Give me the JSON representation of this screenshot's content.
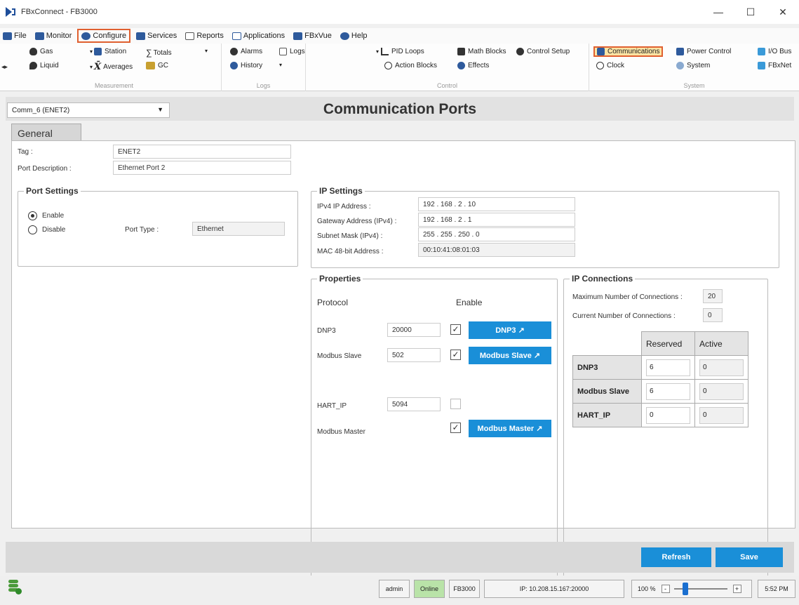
{
  "window": {
    "title": "FBxConnect - FB3000",
    "minimize": "—",
    "maximize": "☐",
    "close": "✕"
  },
  "menu": [
    {
      "label": "File",
      "icon": "folder-icon",
      "color": "#2e5a9c"
    },
    {
      "label": "Monitor",
      "icon": "monitor-icon",
      "color": "#2e5a9c"
    },
    {
      "label": "Configure",
      "icon": "gear-icon",
      "color": "#2e5a9c",
      "selected": true
    },
    {
      "label": "Services",
      "icon": "tools-icon",
      "color": "#2e5a9c"
    },
    {
      "label": "Reports",
      "icon": "report-icon",
      "color": "#555555"
    },
    {
      "label": "Applications",
      "icon": "apps-icon",
      "color": "#2e5a9c"
    },
    {
      "label": "FBxVue",
      "icon": "vue-icon",
      "color": "#2e5a9c"
    },
    {
      "label": "Help",
      "icon": "help-icon",
      "color": "#2e5a9c"
    }
  ],
  "ribbon": {
    "measurement": {
      "label": "Measurement",
      "gas": "Gas",
      "liquid": "Liquid",
      "station": "Station",
      "averages": "Averages",
      "totals": "Totals",
      "gc": "GC"
    },
    "logs": {
      "label": "Logs",
      "alarms": "Alarms",
      "history": "History",
      "logs": "Logs"
    },
    "control": {
      "label": "Control",
      "pid_loops": "PID Loops",
      "action_blocks": "Action Blocks",
      "math_blocks": "Math Blocks",
      "effects": "Effects",
      "control_setup": "Control Setup"
    },
    "system": {
      "label": "System",
      "communications": "Communications",
      "clock": "Clock",
      "power_control": "Power Control",
      "system": "System",
      "io_bus": "I/O Bus",
      "fbxnet": "FBxNet"
    }
  },
  "header": {
    "port_select": "Comm_6 (ENET2)",
    "title": "Communication Ports"
  },
  "tabs": {
    "general": "General"
  },
  "general": {
    "tag_label": "Tag :",
    "tag_value": "ENET2",
    "desc_label": "Port Description :",
    "desc_value": "Ethernet Port 2"
  },
  "port_settings": {
    "title": "Port Settings",
    "enable": "Enable",
    "disable": "Disable",
    "port_type_label": "Port Type :",
    "port_type_value": "Ethernet"
  },
  "ip_settings": {
    "title": "IP Settings",
    "ipv4_label": "IPv4 IP Address :",
    "ipv4_value": "192 . 168 . 2 . 10",
    "gateway_label": "Gateway Address (IPv4) :",
    "gateway_value": "192 . 168 . 2 . 1",
    "subnet_label": "Subnet Mask (IPv4) :",
    "subnet_value": "255 . 255 . 250 . 0",
    "mac_label": "MAC 48-bit Address :",
    "mac_value": "00:10:41:08:01:03"
  },
  "properties": {
    "title": "Properties",
    "protocol_header": "Protocol",
    "enable_header": "Enable",
    "rows": [
      {
        "name": "DNP3",
        "port": "20000",
        "checked": true,
        "button": "DNP3 ↗"
      },
      {
        "name": "Modbus Slave",
        "port": "502",
        "checked": true,
        "button": "Modbus Slave ↗"
      },
      {
        "name": "HART_IP",
        "port": "5094",
        "checked": false,
        "button": ""
      },
      {
        "name": "Modbus Master",
        "port": "",
        "checked": true,
        "button": "Modbus Master ↗"
      }
    ]
  },
  "ip_connections": {
    "title": "IP Connections",
    "max_label": "Maximum Number of Connections :",
    "max_value": "20",
    "current_label": "Current Number of Connections :",
    "current_value": "0",
    "col_reserved": "Reserved",
    "col_active": "Active",
    "rows": [
      {
        "name": "DNP3",
        "reserved": "6",
        "active": "0"
      },
      {
        "name": "Modbus Slave",
        "reserved": "6",
        "active": "0"
      },
      {
        "name": "HART_IP",
        "reserved": "0",
        "active": "0"
      }
    ]
  },
  "actions": {
    "refresh": "Refresh",
    "save": "Save"
  },
  "status": {
    "user": "admin",
    "online": "Online",
    "device": "FB3000",
    "ip": "IP: 10.208.15.167:20000",
    "zoom": "100 %",
    "zoom_minus": "-",
    "zoom_plus": "+",
    "time": "5:52 PM"
  },
  "colors": {
    "accent_blue": "#1a8fd8",
    "highlight_orange": "#e06030",
    "online_green": "#b9e3a8"
  }
}
